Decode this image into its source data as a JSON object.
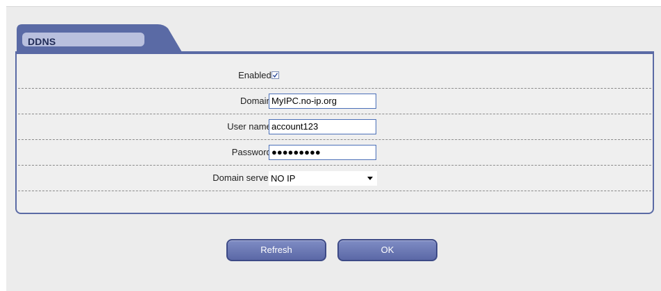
{
  "section": {
    "title": "DDNS"
  },
  "form": {
    "enabled_label": "Enabled :",
    "enabled_checked": true,
    "domain_label": "Domain :",
    "domain_value": "MyIPC.no-ip.org",
    "username_label": "User name :",
    "username_value": "account123",
    "password_label": "Password :",
    "password_mask": "●●●●●●●●●",
    "server_label": "Domain server :",
    "server_value": "NO IP"
  },
  "buttons": {
    "refresh": "Refresh",
    "ok": "OK"
  },
  "colors": {
    "accent": "#5a6aa5",
    "tab_label_bg": "#b9c0de",
    "button": "#6a77b6"
  },
  "icons": {
    "checkbox": "checkmark-icon",
    "dropdown": "chevron-down-icon"
  }
}
